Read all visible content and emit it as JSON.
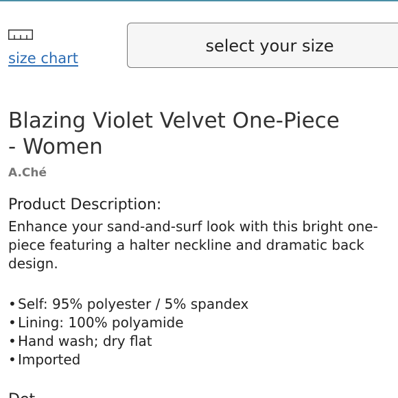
{
  "size_selector": {
    "size_chart_label": "size chart",
    "select_label": "select your size"
  },
  "product": {
    "title_line1": "Blazing Violet Velvet One-Piece",
    "title_line2": "- Women",
    "brand": "A.Ché"
  },
  "description": {
    "heading": "Product Description:",
    "lines": [
      "Enhance your sand-and-surf look with this bright one-",
      "piece featuring a halter neckline and dramatic back",
      "design."
    ],
    "features": [
      "Self: 95% polyester / 5% spandex",
      "Lining: 100% polyamide",
      "Hand wash; dry flat",
      "Imported"
    ]
  },
  "next_section_heading_partial": "Det",
  "colors": {
    "accent_rule": "#4a8fa6",
    "link": "#2a6bb3",
    "brand_text": "#767676"
  },
  "icons": {
    "ruler": "ruler-icon"
  }
}
